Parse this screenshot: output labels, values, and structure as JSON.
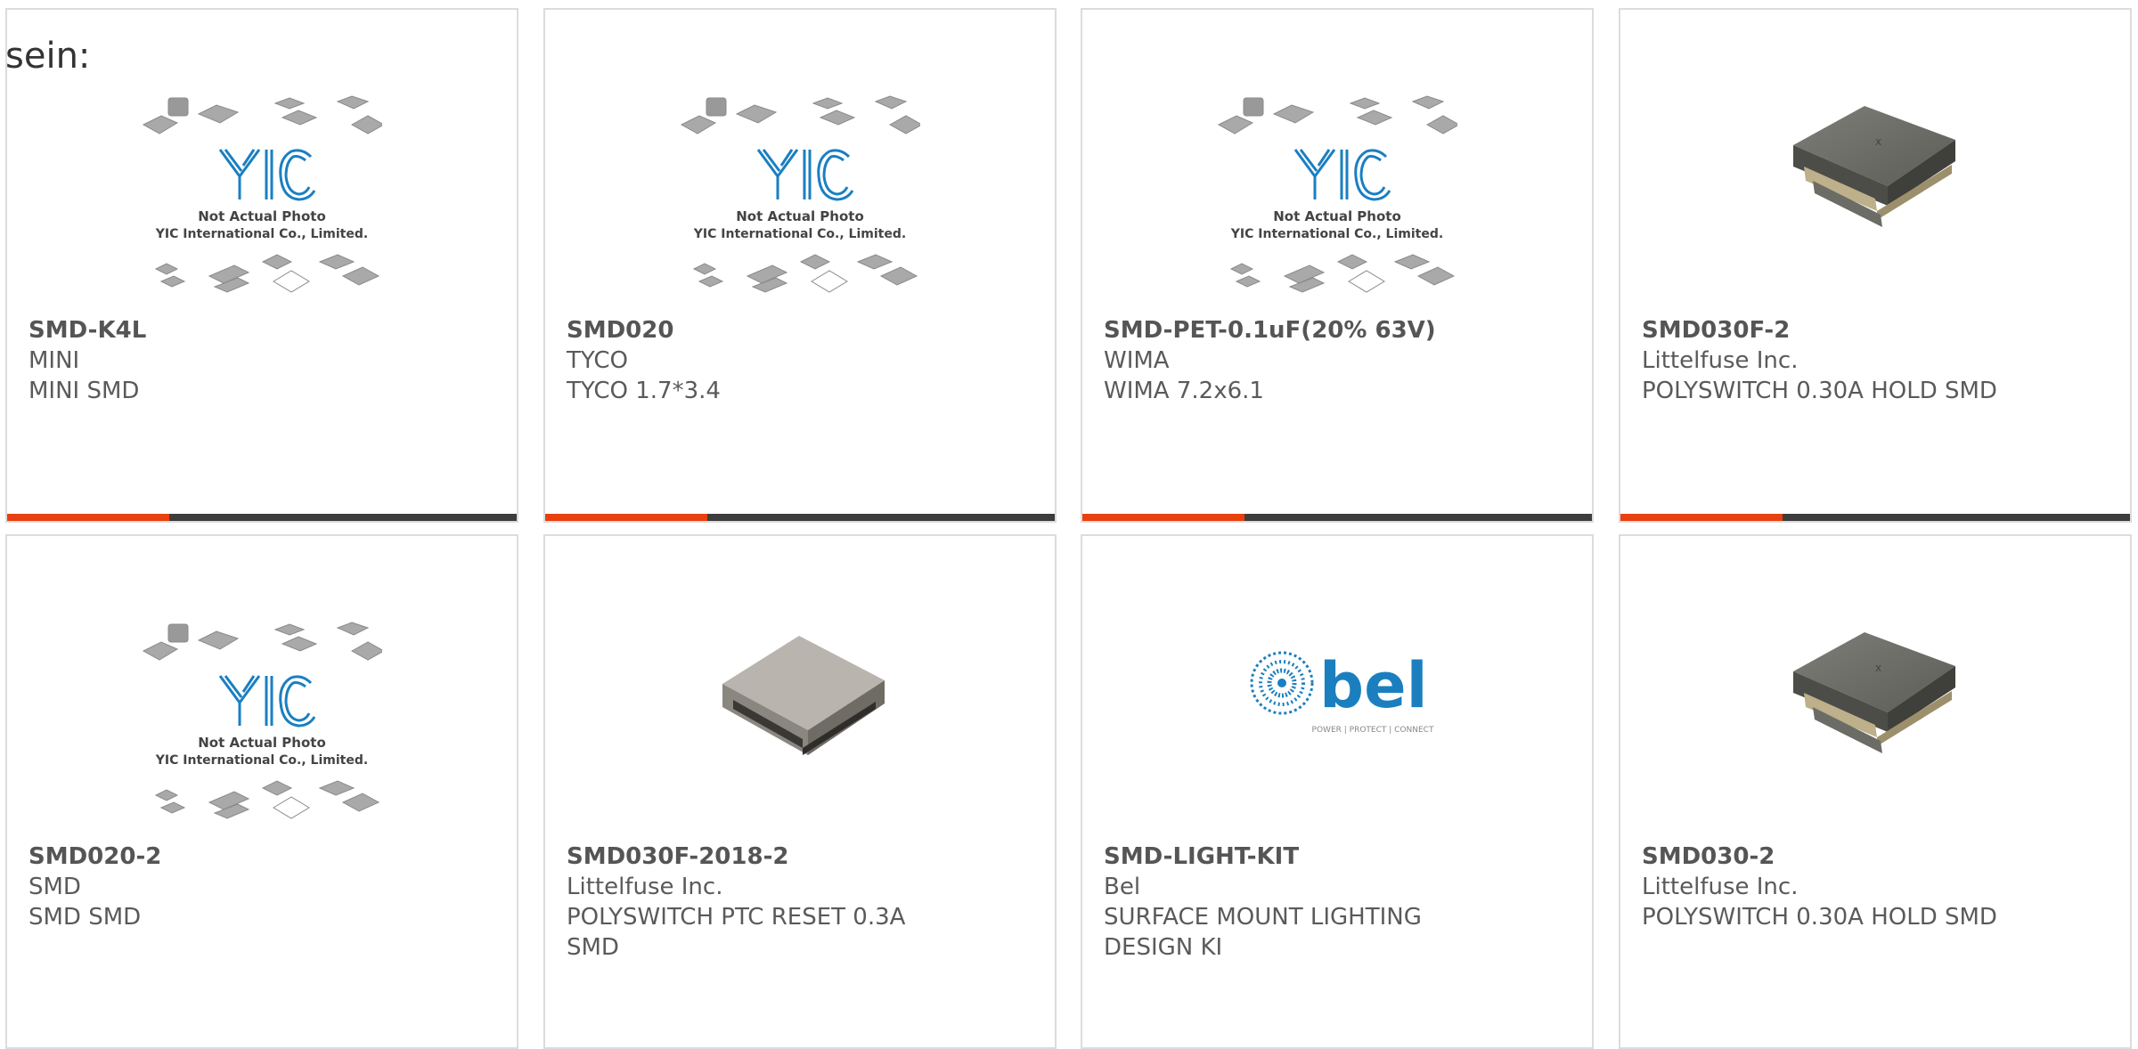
{
  "header_fragment": "sein:",
  "colors": {
    "accent": "#e8400e",
    "bar_dark": "#3d3d3d",
    "border": "#dcdcdc",
    "yic_blue": "#1a7fc1",
    "bel_blue": "#1b7fbf"
  },
  "placeholder": {
    "line1": "Not Actual Photo",
    "line2": "YIC International Co., Limited."
  },
  "bel_logo": {
    "word": "bel",
    "tagline": "POWER | PROTECT | CONNECT"
  },
  "products": [
    {
      "part": "SMD-K4L",
      "maker": "MINI",
      "desc": "MINI SMD",
      "image": "yic-placeholder"
    },
    {
      "part": "SMD020",
      "maker": "TYCO",
      "desc": "TYCO 1.7*3.4",
      "image": "yic-placeholder"
    },
    {
      "part": "SMD-PET-0.1uF(20% 63V)",
      "maker": "WIMA",
      "desc": "WIMA 7.2x6.1",
      "image": "yic-placeholder"
    },
    {
      "part": "SMD030F-2",
      "maker": "Littelfuse Inc.",
      "desc": "POLYSWITCH 0.30A HOLD SMD",
      "image": "polyswitch-photo"
    },
    {
      "part": "SMD020-2",
      "maker": "SMD",
      "desc": "SMD SMD",
      "image": "yic-placeholder"
    },
    {
      "part": "SMD030F-2018-2",
      "maker": "Littelfuse Inc.",
      "desc": "POLYSWITCH PTC RESET 0.3A SMD",
      "image": "ptc-photo"
    },
    {
      "part": "SMD-LIGHT-KIT",
      "maker": "Bel",
      "desc": "SURFACE MOUNT LIGHTING DESIGN KI",
      "image": "bel-logo"
    },
    {
      "part": "SMD030-2",
      "maker": "Littelfuse Inc.",
      "desc": "POLYSWITCH 0.30A HOLD SMD",
      "image": "polyswitch-photo"
    }
  ]
}
